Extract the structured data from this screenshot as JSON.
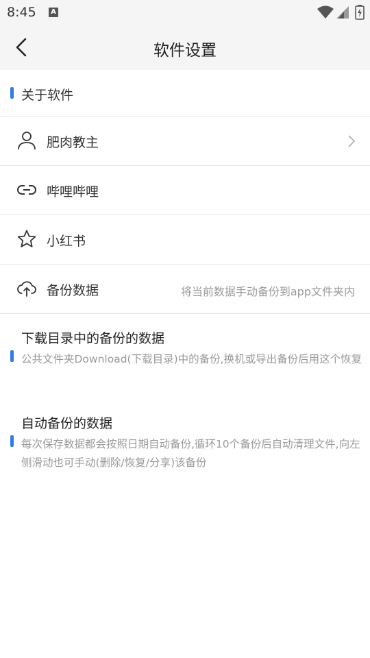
{
  "status_bar": {
    "time": "8:45",
    "notification_icon": "A",
    "icons": [
      "wifi-icon",
      "signal-icon",
      "battery-charging-icon"
    ]
  },
  "header": {
    "title": "软件设置",
    "back_icon": "chevron-left-icon"
  },
  "section": {
    "label": "关于软件",
    "accent_color": "#2f7af0"
  },
  "rows": [
    {
      "label": "肥肉教主",
      "icon": "user-icon",
      "hint": "",
      "has_chevron": true
    },
    {
      "label": "哔哩哔哩",
      "icon": "link-icon",
      "hint": "",
      "has_chevron": false
    },
    {
      "label": "小红书",
      "icon": "star-icon",
      "hint": "",
      "has_chevron": false
    },
    {
      "label": "备份数据",
      "icon": "cloud-upload-icon",
      "hint": "将当前数据手动备份到app文件夹内",
      "has_chevron": false
    }
  ],
  "info_blocks": [
    {
      "title": "下载目录中的备份的数据",
      "description": "公共文件夹Download(下载目录)中的备份,换机或导出备份后用这个恢复"
    },
    {
      "title": "自动备份的数据",
      "description": "每次保存数据都会按照日期自动备份,循环10个备份后自动清理文件,向左侧滑动也可手动(删除/恢复/分享)该备份"
    }
  ]
}
